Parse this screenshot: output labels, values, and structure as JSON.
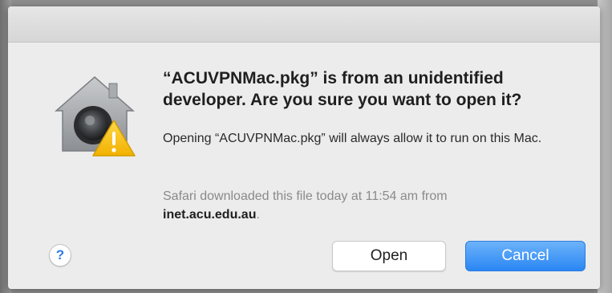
{
  "dialog": {
    "heading": "“ACUVPNMac.pkg” is from an unidentified developer. Are you sure you want to open it?",
    "message": "Opening “ACUVPNMac.pkg” will always allow it to run on this Mac.",
    "source_prefix": "Safari downloaded this file today at 11:54 am from",
    "source_domain": "inet.acu.edu.au",
    "source_suffix": ".",
    "icon": "gatekeeper-warning-icon",
    "help_label": "?",
    "buttons": {
      "open_label": "Open",
      "cancel_label": "Cancel"
    }
  },
  "colors": {
    "dialog_bg": "#ececec",
    "accent": "#2a86f3",
    "warning": "#f5c000"
  }
}
